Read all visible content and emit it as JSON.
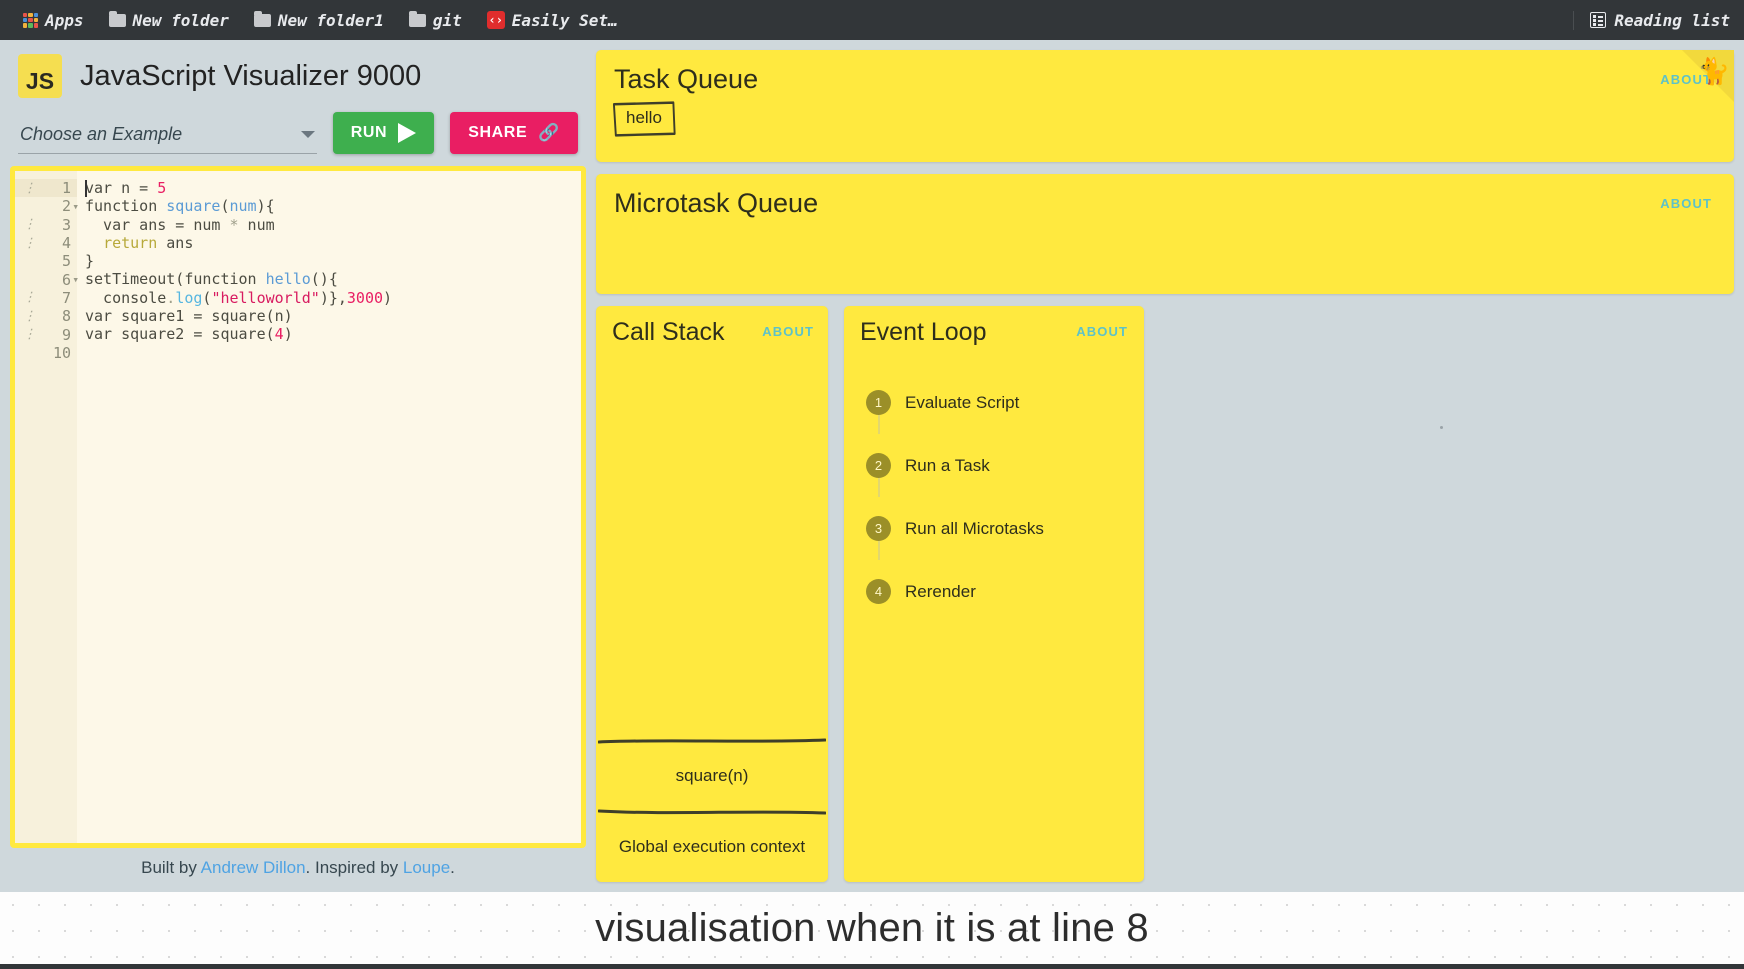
{
  "browser": {
    "bookmarks": [
      {
        "label": "Apps",
        "icon": "apps-grid-icon"
      },
      {
        "label": "New folder",
        "icon": "folder-icon"
      },
      {
        "label": "New folder1",
        "icon": "folder-icon"
      },
      {
        "label": "git",
        "icon": "folder-icon"
      },
      {
        "label": "Easily Set…",
        "icon": "code-brackets-icon"
      }
    ],
    "reading_list": "Reading list"
  },
  "header": {
    "logo_text": "JS",
    "title": "JavaScript Visualizer 9000",
    "example_select_value": "Choose an Example",
    "run_label": "RUN",
    "share_label": "SHARE"
  },
  "editor": {
    "lines": [
      {
        "num": "1",
        "breakpoint": true,
        "fold": false,
        "active": true
      },
      {
        "num": "2",
        "breakpoint": false,
        "fold": true,
        "active": false
      },
      {
        "num": "3",
        "breakpoint": true,
        "fold": false,
        "active": false
      },
      {
        "num": "4",
        "breakpoint": true,
        "fold": false,
        "active": false
      },
      {
        "num": "5",
        "breakpoint": false,
        "fold": false,
        "active": false
      },
      {
        "num": "6",
        "breakpoint": false,
        "fold": true,
        "active": false
      },
      {
        "num": "7",
        "breakpoint": true,
        "fold": false,
        "active": false
      },
      {
        "num": "8",
        "breakpoint": true,
        "fold": false,
        "active": false
      },
      {
        "num": "9",
        "breakpoint": true,
        "fold": false,
        "active": false
      },
      {
        "num": "10",
        "breakpoint": false,
        "fold": false,
        "active": false
      }
    ],
    "code_text": "var n = 5\nfunction square(num){\n  var ans = num * num\n  return ans\n}\nsetTimeout(function hello(){\n  console.log(\"helloworld\")},3000)\nvar square1 = square(n)\nvar square2 = square(4)\n"
  },
  "footer": {
    "prefix": "Built by ",
    "author": "Andrew Dillon",
    "middle": ". Inspired by ",
    "inspiration": "Loupe",
    "suffix": "."
  },
  "panels": {
    "about_label": "ABOUT",
    "task_queue": {
      "title": "Task Queue",
      "items": [
        "hello"
      ]
    },
    "microtask_queue": {
      "title": "Microtask Queue",
      "items": []
    },
    "call_stack": {
      "title": "Call Stack",
      "frames": [
        "square(n)",
        "Global execution context"
      ]
    },
    "event_loop": {
      "title": "Event Loop",
      "steps": [
        {
          "num": "1",
          "label": "Evaluate Script"
        },
        {
          "num": "2",
          "label": "Run a Task"
        },
        {
          "num": "3",
          "label": "Run all Microtasks"
        },
        {
          "num": "4",
          "label": "Rerender"
        }
      ]
    }
  },
  "corner": {
    "icon": "cat-silhouette-icon"
  },
  "caption": {
    "text": "visualisation when it is at line 8"
  },
  "colors": {
    "panel_yellow": "#ffe93f",
    "app_background": "#cfd8dc",
    "run_green": "#3eaf4e",
    "share_pink": "#e91e63",
    "about_teal": "#5ec2c8",
    "link_blue": "#4fa3e3",
    "loop_badge": "#9b8f28"
  }
}
